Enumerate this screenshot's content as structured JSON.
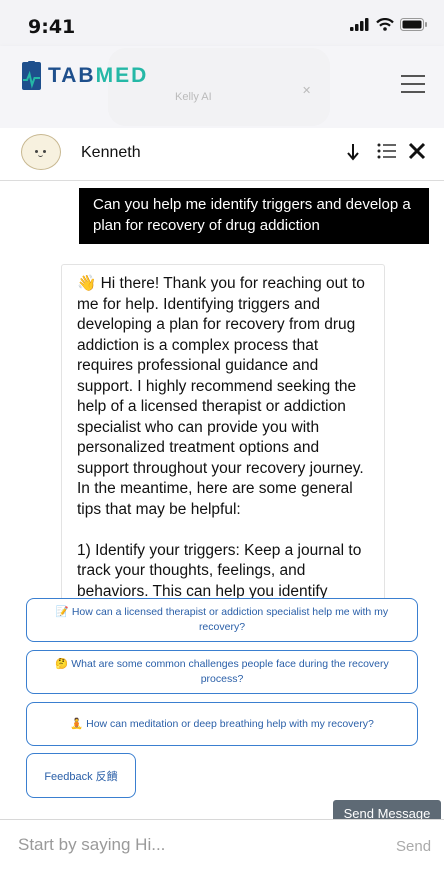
{
  "status_bar": {
    "time": "9:41"
  },
  "ghost_card": {
    "name": "Kelly AI"
  },
  "header": {
    "brand_main": "TAB",
    "brand_accent": "MED"
  },
  "chat": {
    "contact_name": "Kenneth",
    "user_message": "Can you help me identify triggers and develop a plan for recovery of drug addiction",
    "bot_message": "👋 Hi there! Thank you for reaching out to me for help. Identifying triggers and developing a plan for recovery from drug addiction is a complex process that requires professional guidance and support. I highly recommend seeking the help of a licensed therapist or addiction specialist who can provide you with personalized treatment options and support throughout your recovery journey. In the meantime, here are some general tips that may be helpful:\n\n1) Identify your triggers: Keep a journal to track your thoughts, feelings, and behaviors. This can help you identify patterns and triggers that lead to drug use."
  },
  "suggestions": [
    "📝 How can a licensed therapist or addiction specialist help me with my recovery?",
    "🤔 What are some common challenges people face during the recovery process?",
    "🧘 How can meditation or deep breathing help with my recovery?"
  ],
  "feedback_label": "Feedback 反饋",
  "tooltip": "Send Message",
  "input": {
    "placeholder": "Start by saying Hi...",
    "send_label": "Send"
  },
  "colors": {
    "brand_blue": "#1e4f8c",
    "brand_teal": "#25b8a6",
    "suggestion_border": "#3a7fd0"
  },
  "icons": [
    "signal-icon",
    "wifi-icon",
    "battery-icon",
    "logo-icon",
    "hamburger-menu-icon",
    "arrow-down-icon",
    "list-icon",
    "close-icon"
  ]
}
